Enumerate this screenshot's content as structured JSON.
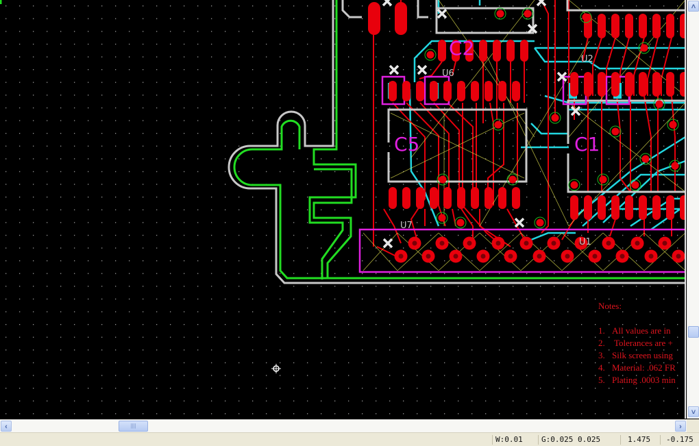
{
  "board": {
    "refdes": {
      "c2": "C2",
      "c5": "C5",
      "c1": "C1",
      "u6": "U6",
      "u2": "U2",
      "u7": "U7",
      "u1": "U1"
    },
    "colors": {
      "background": "#000000",
      "outline": "#c8c8c8",
      "keepout": "#22dd22",
      "top_copper": "#e8000c",
      "inner_copper": "#22d6e0",
      "silk": "#e020e0",
      "ratsnest": "#e6e650"
    }
  },
  "notes": {
    "title": "Notes:",
    "items": [
      {
        "num": "1.",
        "text": "All values are in"
      },
      {
        "num": "2.",
        "text": " Tolerances are +"
      },
      {
        "num": "3.",
        "text": "Silk screen using"
      },
      {
        "num": "4.",
        "text": "Material: .062 FR"
      },
      {
        "num": "5.",
        "text": "Plating .0003 min"
      }
    ]
  },
  "scrollbars": {
    "up": "˄",
    "down": "˅",
    "left": "‹",
    "right": "›",
    "grip": "||||"
  },
  "status": {
    "width": "W:0.01",
    "grid": "G:0.025 0.025",
    "x": "1.475",
    "y": "-0.175"
  }
}
